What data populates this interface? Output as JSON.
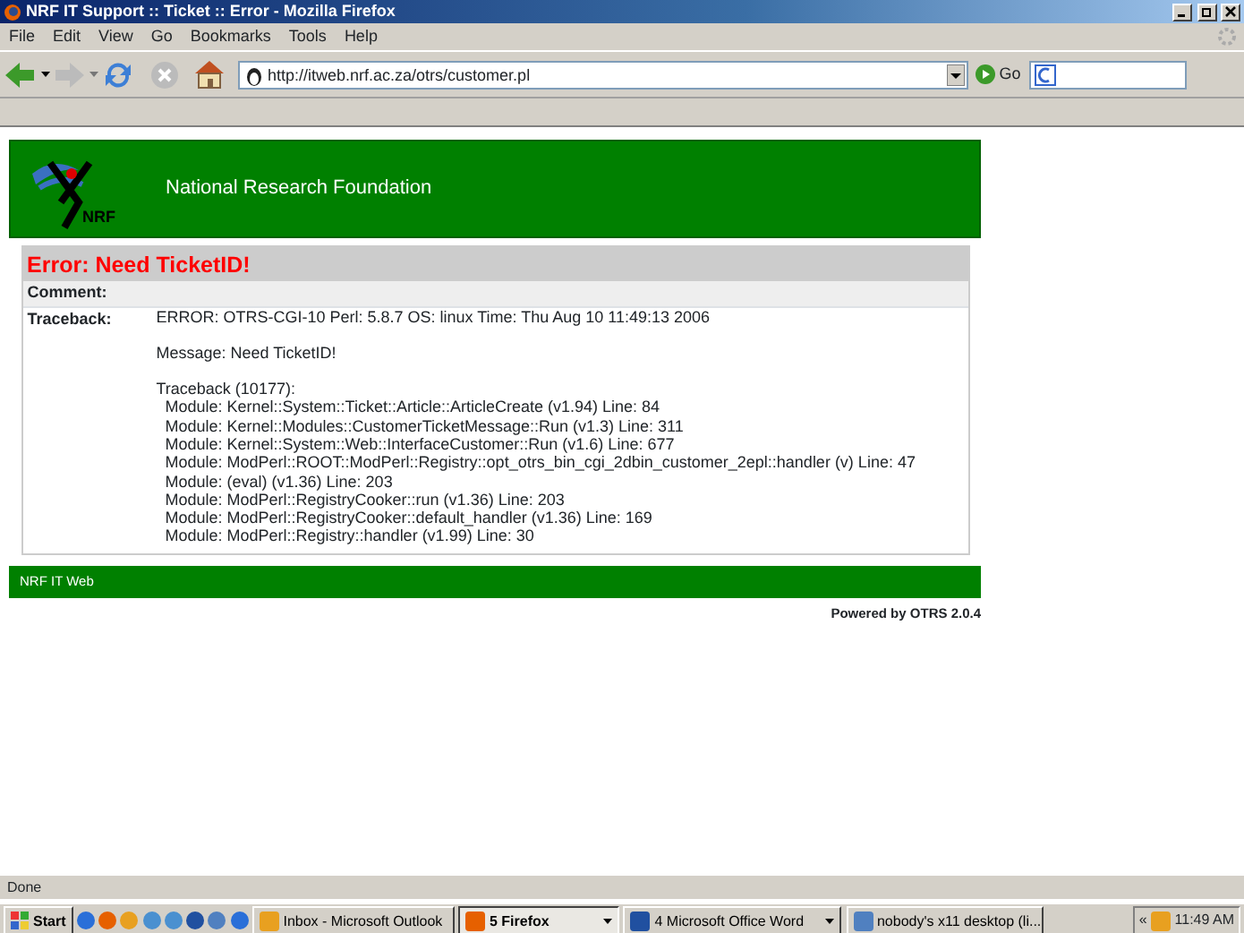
{
  "window": {
    "title": "NRF IT Support :: Ticket :: Error - Mozilla Firefox"
  },
  "menu": [
    "File",
    "Edit",
    "View",
    "Go",
    "Bookmarks",
    "Tools",
    "Help"
  ],
  "toolbar": {
    "address": "http://itweb.nrf.ac.za/otrs/customer.pl",
    "go_label": "Go"
  },
  "page": {
    "header": {
      "logo_text": "NRF",
      "org_name": "National Research Foundation"
    },
    "error_title": "Error: Need TicketID!",
    "comment_label": "Comment:",
    "traceback_label": "Traceback:",
    "error_line": "ERROR: OTRS-CGI-10 Perl: 5.8.7 OS: linux Time: Thu Aug 10 11:49:13 2006",
    "message": "Message: Need TicketID!",
    "traceback_header": "Traceback (10177):",
    "modules": [
      "Module: Kernel::System::Ticket::Article::ArticleCreate (v1.94) Line: 84",
      "Module: Kernel::Modules::CustomerTicketMessage::Run (v1.3) Line: 311",
      "Module: Kernel::System::Web::InterfaceCustomer::Run (v1.6) Line: 677",
      "Module: ModPerl::ROOT::ModPerl::Registry::opt_otrs_bin_cgi_2dbin_customer_2epl::handler (v) Line: 47",
      "Module: (eval) (v1.36) Line: 203",
      "Module: ModPerl::RegistryCooker::run (v1.36) Line: 203",
      "Module: ModPerl::RegistryCooker::default_handler (v1.36) Line: 169",
      "Module: ModPerl::Registry::handler (v1.99) Line: 30"
    ],
    "footer": "NRF IT Web",
    "powered_by": "Powered by OTRS 2.0.4"
  },
  "status_bar": "Done",
  "taskbar": {
    "start": "Start",
    "tasks": [
      {
        "label": "Inbox - Microsoft Outlook",
        "selected": false,
        "dropdown": false
      },
      {
        "label": "5 Firefox",
        "selected": true,
        "dropdown": true
      },
      {
        "label": "4 Microsoft Office Word",
        "selected": false,
        "dropdown": true
      },
      {
        "label": "nobody's x11 desktop (li...",
        "selected": false,
        "dropdown": false
      }
    ],
    "tray_toggle": "«",
    "clock": "11:49 AM"
  }
}
